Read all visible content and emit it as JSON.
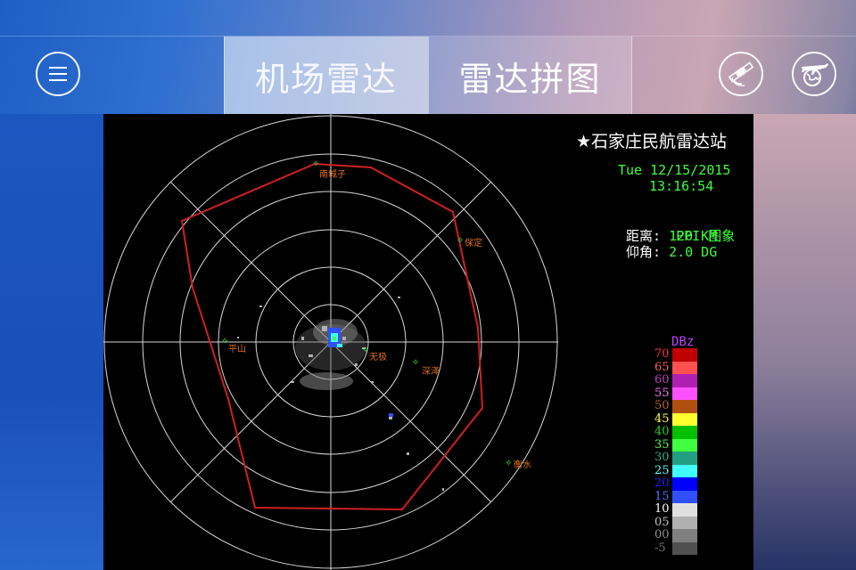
{
  "header": {
    "tabs": [
      {
        "label": "机场雷达",
        "active": true
      },
      {
        "label": "雷达拼图",
        "active": false
      }
    ],
    "menu_icon": "hamburger-menu-icon",
    "right_icons": [
      "satellite-icon",
      "globe-plane-icon"
    ]
  },
  "radar": {
    "station": "★石家庄民航雷达站",
    "date": "Tue 12/15/2015",
    "time": "13:16:54",
    "product": "PPI 图象",
    "range_label": "距离:",
    "range_value": "120 KM",
    "elevation_label": "仰角:",
    "elevation_value": "2.0 DG",
    "places": [
      "南城子",
      "保定",
      "平山",
      "无极",
      "深泽",
      "衡水"
    ],
    "legend_title": "DBz",
    "legend": [
      {
        "label": "70",
        "color": "#c00000",
        "text_color": "#ff3030"
      },
      {
        "label": "65",
        "color": "#ff5050",
        "text_color": "#ff6060"
      },
      {
        "label": "60",
        "color": "#b020b0",
        "text_color": "#c040c0"
      },
      {
        "label": "55",
        "color": "#ff50ff",
        "text_color": "#ff70ff"
      },
      {
        "label": "50",
        "color": "#b05010",
        "text_color": "#c06020"
      },
      {
        "label": "45",
        "color": "#ffff30",
        "text_color": "#ffff40"
      },
      {
        "label": "40",
        "color": "#00c000",
        "text_color": "#20d020"
      },
      {
        "label": "35",
        "color": "#40ff40",
        "text_color": "#50ff50"
      },
      {
        "label": "30",
        "color": "#20a080",
        "text_color": "#30b090"
      },
      {
        "label": "25",
        "color": "#40ffff",
        "text_color": "#60ffff"
      },
      {
        "label": "20",
        "color": "#0000ff",
        "text_color": "#2020ff"
      },
      {
        "label": "15",
        "color": "#3050ff",
        "text_color": "#5070ff"
      },
      {
        "label": "10",
        "color": "#e0e0e0",
        "text_color": "#ffffff"
      },
      {
        "label": "05",
        "color": "#b0b0b0",
        "text_color": "#c0c0c0"
      },
      {
        "label": "00",
        "color": "#808080",
        "text_color": "#909090"
      },
      {
        "label": "-5",
        "color": "#505050",
        "text_color": "#707070"
      }
    ]
  }
}
